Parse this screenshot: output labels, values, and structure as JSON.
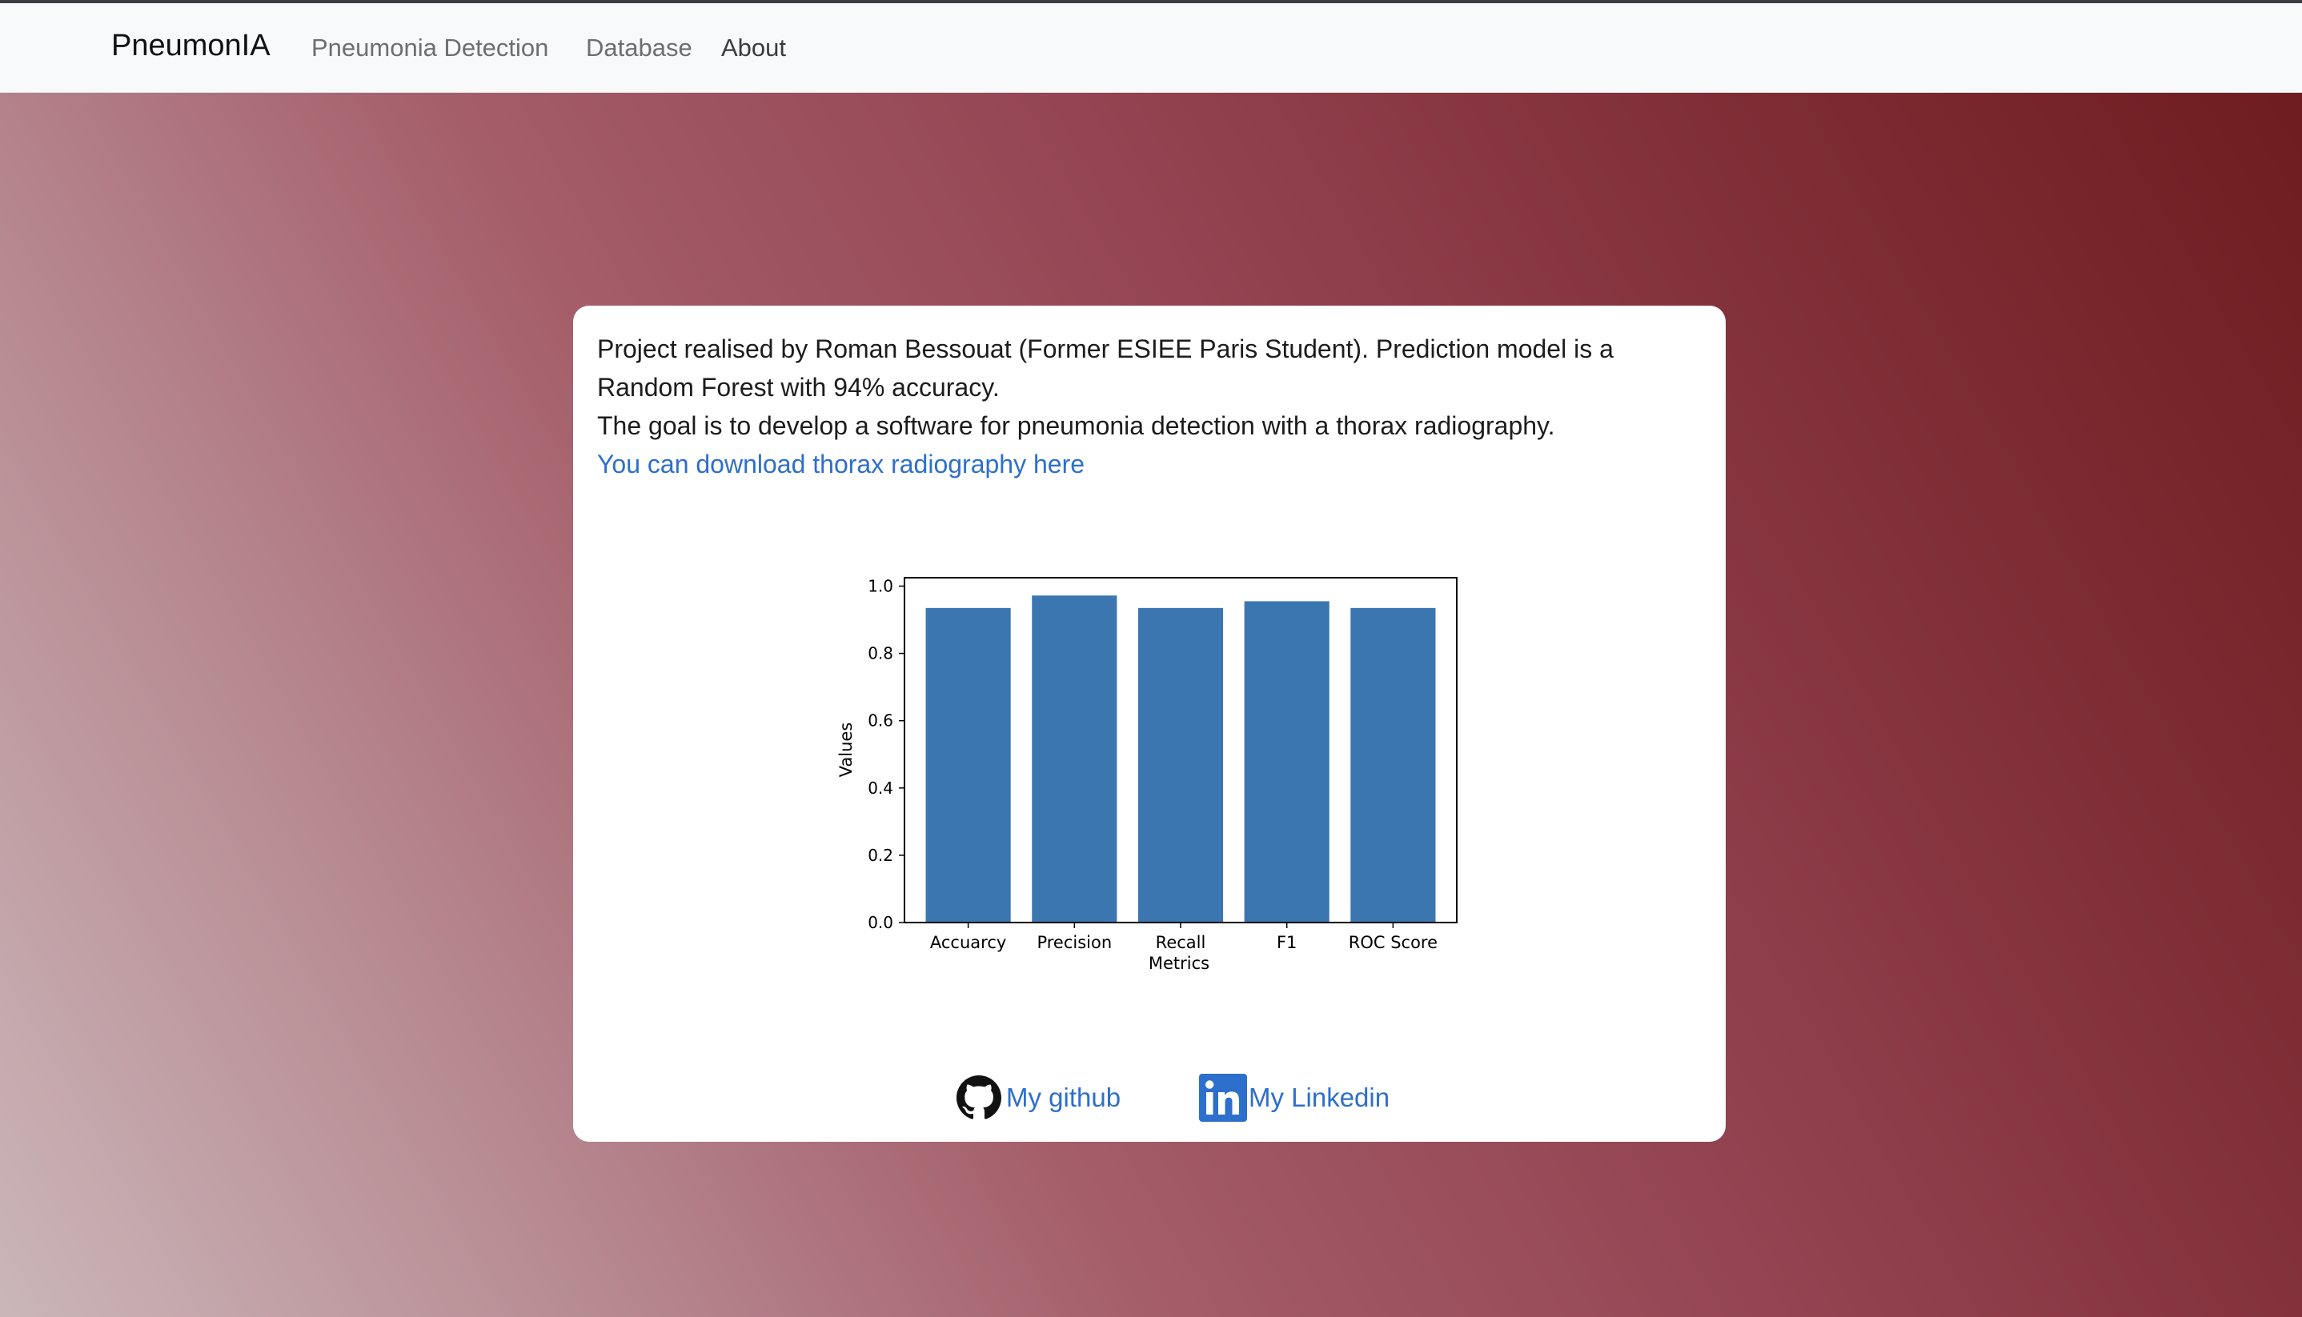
{
  "nav": {
    "brand": "PneumonIA",
    "links": [
      {
        "label": "Pneumonia Detection"
      },
      {
        "label": "Database"
      },
      {
        "label": "About",
        "active": true
      }
    ]
  },
  "about": {
    "line1": "Project realised by Roman Bessouat (Former ESIEE Paris Student). Prediction model is a Random Forest with 94% accuracy.",
    "line2": "The goal is to develop a software for pneumonia detection with a thorax radiography.",
    "download_link": "You can download thorax radiography here"
  },
  "chart_data": {
    "type": "bar",
    "categories": [
      "Accuarcy",
      "Precision",
      "Recall",
      "F1",
      "ROC Score"
    ],
    "values": [
      0.935,
      0.972,
      0.935,
      0.955,
      0.935
    ],
    "title": "",
    "xlabel": "Metrics",
    "ylabel": "Values",
    "ylim": [
      0,
      1.025
    ],
    "yticks": [
      "0.0",
      "0.2",
      "0.4",
      "0.6",
      "0.8",
      "1.0"
    ],
    "bar_color": "#3b76b0",
    "grid": false
  },
  "social": {
    "github_label": "My github",
    "linkedin_label": "My Linkedin",
    "github_icon": "github-icon",
    "linkedin_icon": "linkedin-icon"
  },
  "colors": {
    "link": "#2d6fcc",
    "navbar_bg": "#f8f9fa",
    "background_start": "#cab6b9",
    "background_end": "#6c1b1d"
  }
}
